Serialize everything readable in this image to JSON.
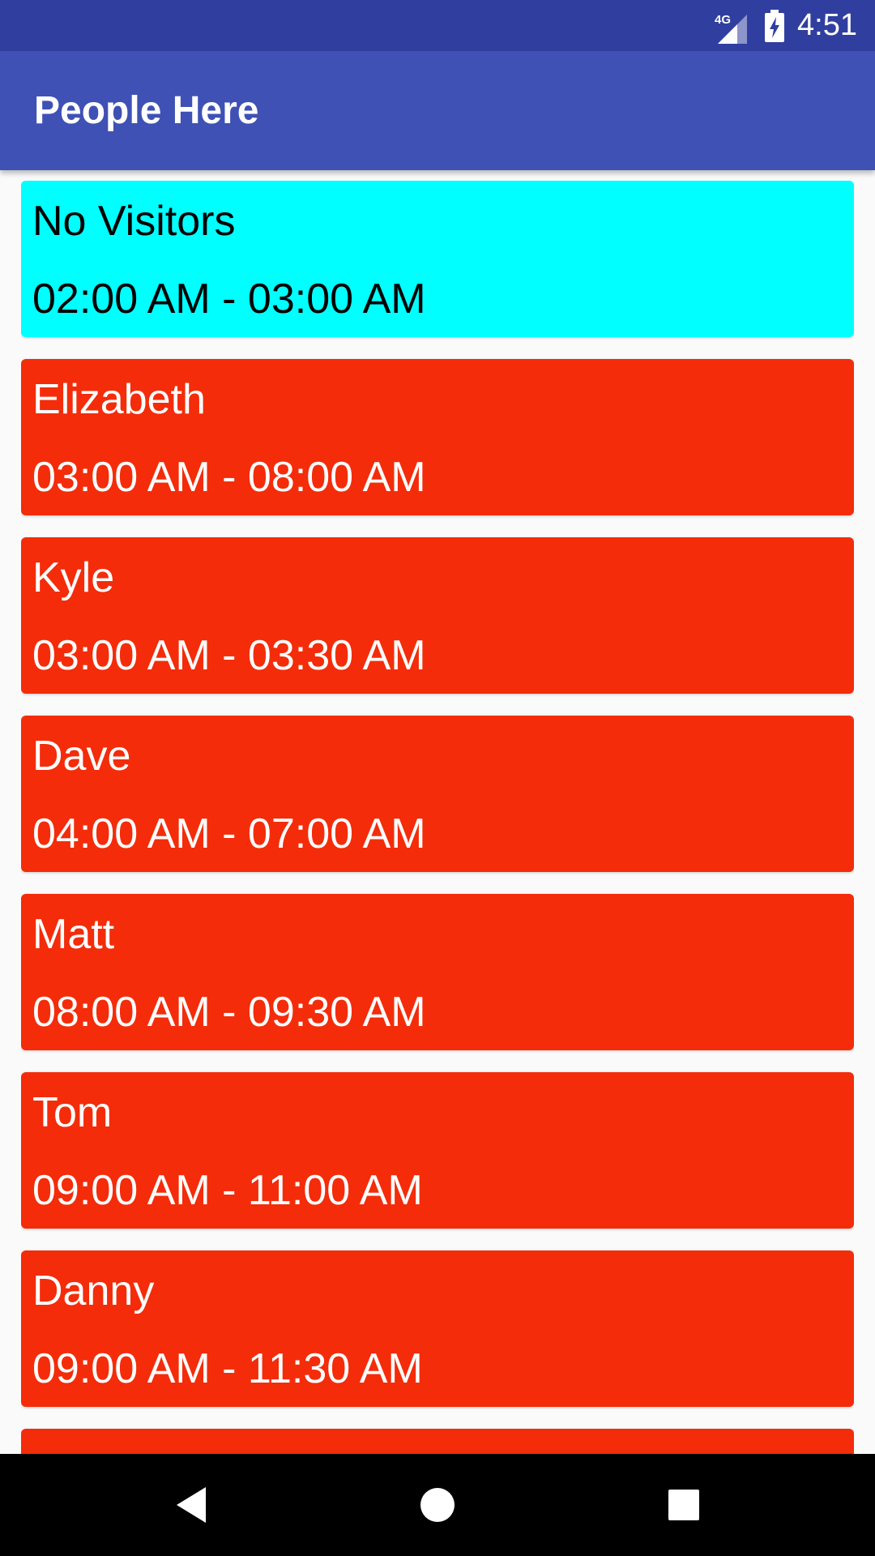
{
  "status_bar": {
    "network_label": "4G",
    "time": "4:51",
    "icons": [
      "signal-icon",
      "battery-charging-icon"
    ]
  },
  "app_bar": {
    "title": "People Here"
  },
  "colors": {
    "status_bar": "#303F9F",
    "app_bar": "#3F51B5",
    "no_visitor_card": "#00FFFF",
    "visitor_card": "#F42C0A",
    "background": "#FAFAFA"
  },
  "entries": [
    {
      "name": "No Visitors",
      "time": "02:00 AM - 03:00 AM",
      "status": "empty"
    },
    {
      "name": "Elizabeth",
      "time": "03:00 AM - 08:00 AM",
      "status": "visitor"
    },
    {
      "name": "Kyle",
      "time": "03:00 AM - 03:30 AM",
      "status": "visitor"
    },
    {
      "name": "Dave",
      "time": "04:00 AM - 07:00 AM",
      "status": "visitor"
    },
    {
      "name": "Matt",
      "time": "08:00 AM - 09:30 AM",
      "status": "visitor"
    },
    {
      "name": "Tom",
      "time": "09:00 AM - 11:00 AM",
      "status": "visitor"
    },
    {
      "name": "Danny",
      "time": "09:00 AM - 11:30 AM",
      "status": "visitor"
    },
    {
      "name": "",
      "time": "",
      "status": "visitor"
    }
  ],
  "nav_bar": {
    "buttons": [
      "back-icon",
      "home-icon",
      "recents-icon"
    ]
  }
}
